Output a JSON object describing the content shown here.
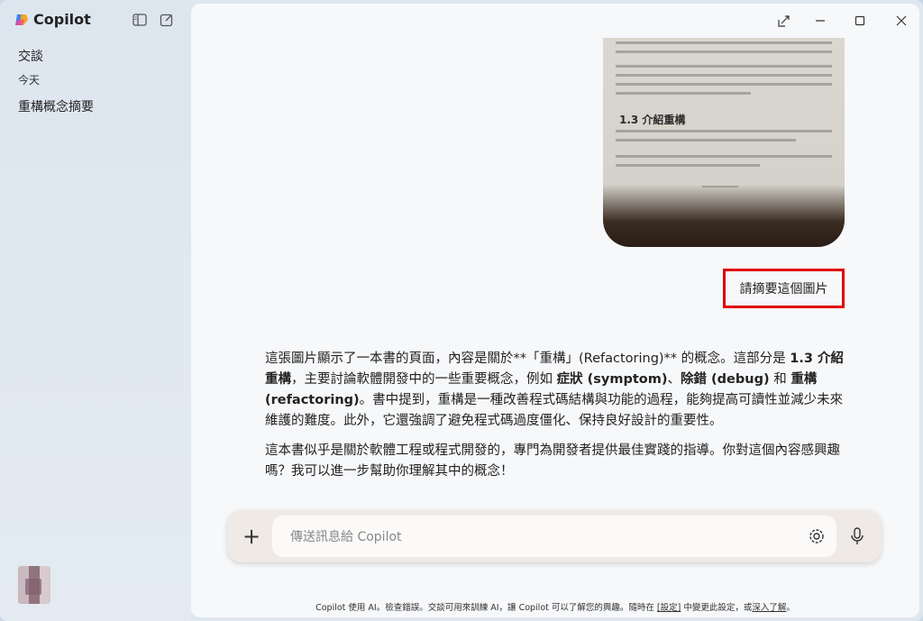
{
  "app": {
    "brand": "Copilot"
  },
  "sidebar": {
    "section_title": "交談",
    "group_label": "今天",
    "items": [
      {
        "label": "重構概念摘要"
      }
    ]
  },
  "conversation": {
    "user_message": "請摘要這個圖片",
    "photo": {
      "heading": "1.3 介紹重構"
    },
    "assistant": {
      "p1": {
        "a": "這張圖片顯示了一本書的頁面，內容是關於**「重構」(Refactoring)** 的概念。這部分是 ",
        "b1": "1.3 介紹重構",
        "c": "，主要討論軟體開發中的一些重要概念，例如 ",
        "b2": "症狀 (symptom)",
        "d": "、",
        "b3": "除錯 (debug)",
        "e": " 和 ",
        "b4": "重構 (refactoring)",
        "f": "。書中提到，重構是一種改善程式碼結構與功能的過程，能夠提高可讀性並減少未來維護的難度。此外，它還強調了避免程式碼過度僵化、保持良好設計的重要性。"
      },
      "p2": "這本書似乎是關於軟體工程或程式開發的，專門為開發者提供最佳實踐的指導。你對這個內容感興趣嗎？我可以進一步幫助你理解其中的概念！"
    }
  },
  "composer": {
    "placeholder": "傳送訊息給 Copilot"
  },
  "footer": {
    "text_before": "Copilot 使用 AI。檢查錯誤。交談可用來訓練 AI，讓 Copilot 可以了解您的興趣。隨時在 ",
    "settings_link": "[設定]",
    "text_middle": " 中變更此設定，或",
    "learn_link": "深入了解",
    "text_after": "。"
  }
}
